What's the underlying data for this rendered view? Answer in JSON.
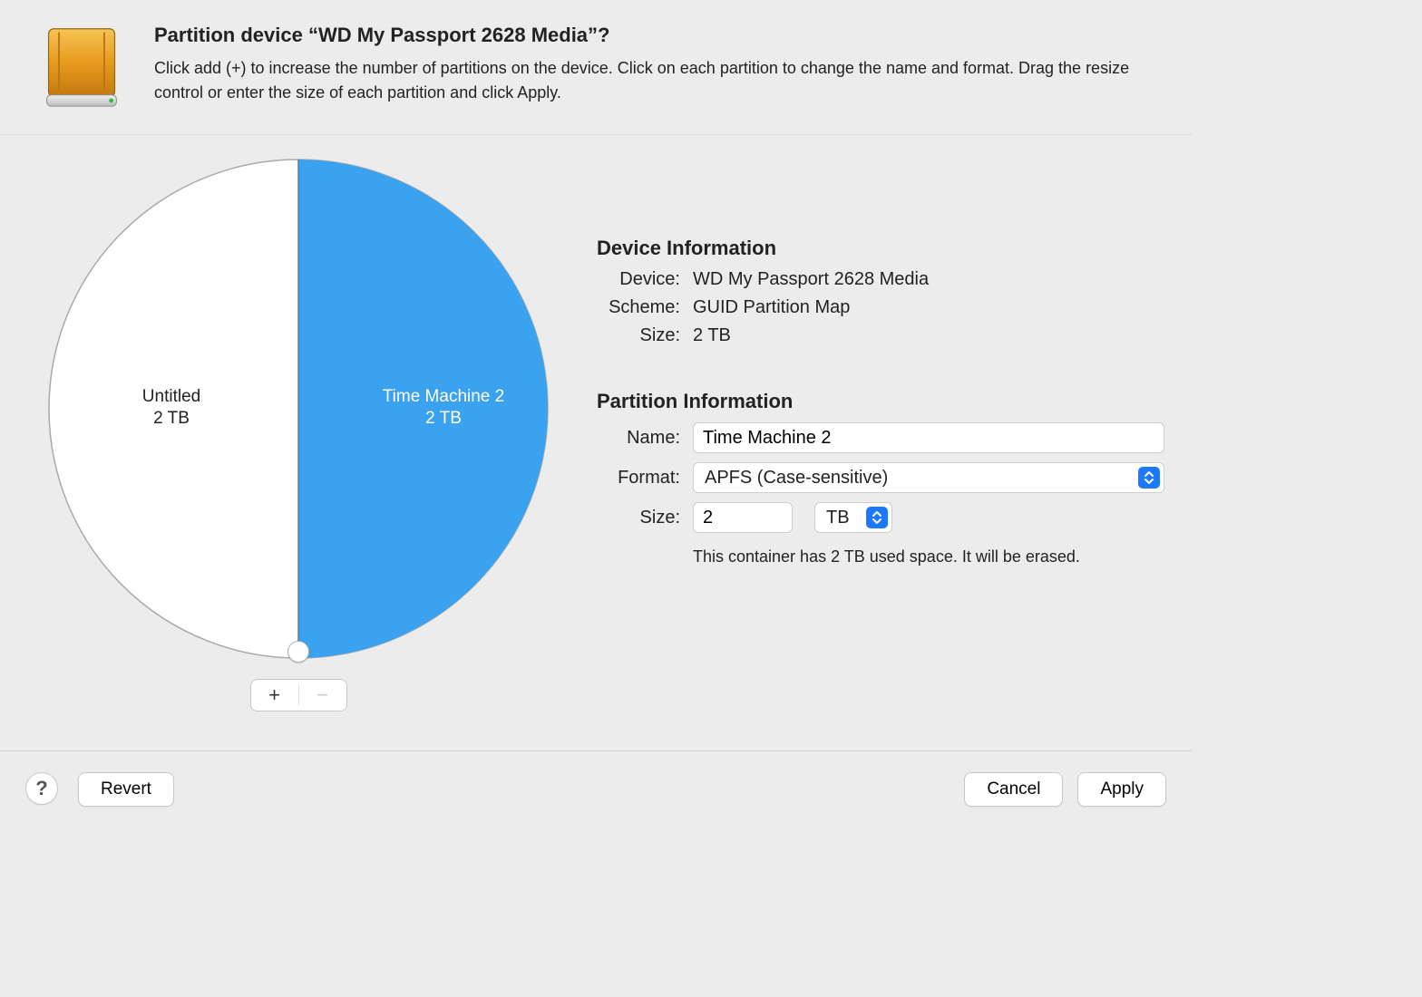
{
  "header": {
    "title": "Partition device “WD My Passport 2628 Media”?",
    "description": "Click add (+) to increase the number of partitions on the device. Click on each partition to change the name and format. Drag the resize control or enter the size of each partition and click Apply."
  },
  "chart_data": {
    "type": "pie",
    "title": "",
    "series": [
      {
        "name": "Untitled",
        "size_label": "2 TB",
        "fraction": 0.5,
        "selected": false,
        "color": "#ffffff"
      },
      {
        "name": "Time Machine 2",
        "size_label": "2 TB",
        "fraction": 0.5,
        "selected": true,
        "color": "#3ba2ef"
      }
    ]
  },
  "controls": {
    "add_label": "+",
    "remove_label": "−",
    "remove_enabled": false
  },
  "device_info": {
    "heading": "Device Information",
    "labels": {
      "device": "Device:",
      "scheme": "Scheme:",
      "size": "Size:"
    },
    "device": "WD My Passport 2628 Media",
    "scheme": "GUID Partition Map",
    "size": "2 TB"
  },
  "partition_info": {
    "heading": "Partition Information",
    "labels": {
      "name": "Name:",
      "format": "Format:",
      "size": "Size:"
    },
    "name_value": "Time Machine 2",
    "format_value": "APFS (Case-sensitive)",
    "size_value": "2",
    "size_unit": "TB",
    "note": "This container has 2 TB used space. It will be erased."
  },
  "footer": {
    "help": "?",
    "revert": "Revert",
    "cancel": "Cancel",
    "apply": "Apply"
  }
}
